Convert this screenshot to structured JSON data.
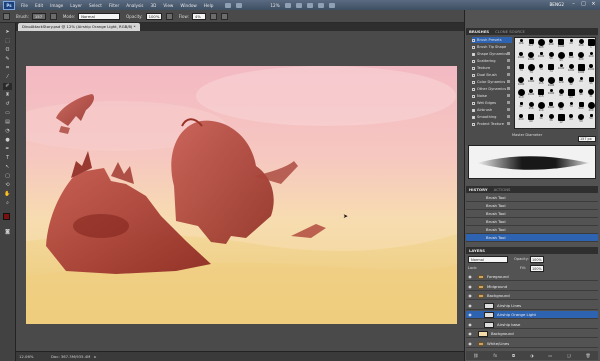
{
  "app": {
    "logo": "Ps",
    "workspace": "BENG2"
  },
  "menu": [
    "File",
    "Edit",
    "Image",
    "Layer",
    "Select",
    "Filter",
    "Analysis",
    "3D",
    "View",
    "Window",
    "Help"
  ],
  "menu_zoom": "12%",
  "options": {
    "brush_label": "Brush:",
    "brush_size": "157",
    "mode_label": "Mode:",
    "mode_value": "Normal",
    "opacity_label": "Opacity:",
    "opacity_value": "100%",
    "flow_label": "Flow:",
    "flow_value": "4%"
  },
  "document": {
    "tab_title": "DinoAttackStory.psd @ 12% (Airship Orange Light, RGB/8) *",
    "zoom": "12.06%",
    "doc_size": "Doc: 367.3M/935.4M"
  },
  "brushes_panel": {
    "tabs": [
      "BRUSHES",
      "CLONE SOURCE"
    ],
    "items": [
      {
        "label": "Brush Presets",
        "checked": false,
        "selected": true
      },
      {
        "label": "Brush Tip Shape",
        "checked": false,
        "selected": false
      },
      {
        "label": "Shape Dynamics",
        "checked": true,
        "selected": false
      },
      {
        "label": "Scattering",
        "checked": false,
        "selected": false
      },
      {
        "label": "Texture",
        "checked": false,
        "selected": false
      },
      {
        "label": "Dual Brush",
        "checked": false,
        "selected": false
      },
      {
        "label": "Color Dynamics",
        "checked": false,
        "selected": false
      },
      {
        "label": "Other Dynamics",
        "checked": false,
        "selected": false
      },
      {
        "label": "Noise",
        "checked": false,
        "selected": false
      },
      {
        "label": "Wet Edges",
        "checked": false,
        "selected": false
      },
      {
        "label": "Airbrush",
        "checked": true,
        "selected": false
      },
      {
        "label": "Smoothing",
        "checked": true,
        "selected": false
      },
      {
        "label": "Protect Texture",
        "checked": false,
        "selected": false
      }
    ],
    "sizes": [
      "166",
      "217",
      "105",
      "200",
      "1000",
      "29",
      "200",
      "1",
      "1000",
      "1000",
      "1000",
      "50",
      "93",
      "200",
      "200",
      "200",
      "74",
      "74",
      "74",
      "74",
      "1000",
      "1000",
      "1000",
      "1000",
      "1000",
      "1000",
      "115",
      "1000",
      "129",
      "32",
      "63",
      "96",
      "113",
      "1000",
      "115",
      "1000",
      "63",
      "63",
      "96",
      "31",
      "42",
      "156",
      "114",
      "1000",
      "54",
      "74",
      "600",
      "200",
      "200",
      "60",
      "16",
      "36",
      "12",
      "24",
      "50",
      "50"
    ],
    "master_diameter_label": "Master Diameter",
    "master_diameter_value": "157 px"
  },
  "history": {
    "tabs": [
      "HISTORY",
      "ACTIONS"
    ],
    "items": [
      "Brush Tool",
      "Brush Tool",
      "Brush Tool",
      "Brush Tool",
      "Brush Tool",
      "Brush Tool"
    ]
  },
  "layers": {
    "tabs": [
      "LAYERS"
    ],
    "blend_mode": "Normal",
    "opacity_label": "Opacity:",
    "opacity_value": "100%",
    "lock_label": "Lock:",
    "fill_label": "Fill:",
    "fill_value": "100%",
    "items": [
      {
        "name": "Foreground",
        "type": "group",
        "selected": false
      },
      {
        "name": "Midground",
        "type": "group",
        "selected": false
      },
      {
        "name": "Background",
        "type": "group",
        "selected": false
      },
      {
        "name": "Airship Lines",
        "type": "layer",
        "selected": false
      },
      {
        "name": "Airship Orange Light",
        "type": "layer",
        "selected": true
      },
      {
        "name": "Airship base",
        "type": "layer",
        "selected": false
      },
      {
        "name": "Background",
        "type": "layer",
        "selected": false
      },
      {
        "name": "White/Lines",
        "type": "group",
        "selected": false
      }
    ]
  },
  "colors": {
    "accent": "#2d63b0",
    "foreground_swatch": "#7a1010",
    "background_swatch": "#ffffff"
  }
}
